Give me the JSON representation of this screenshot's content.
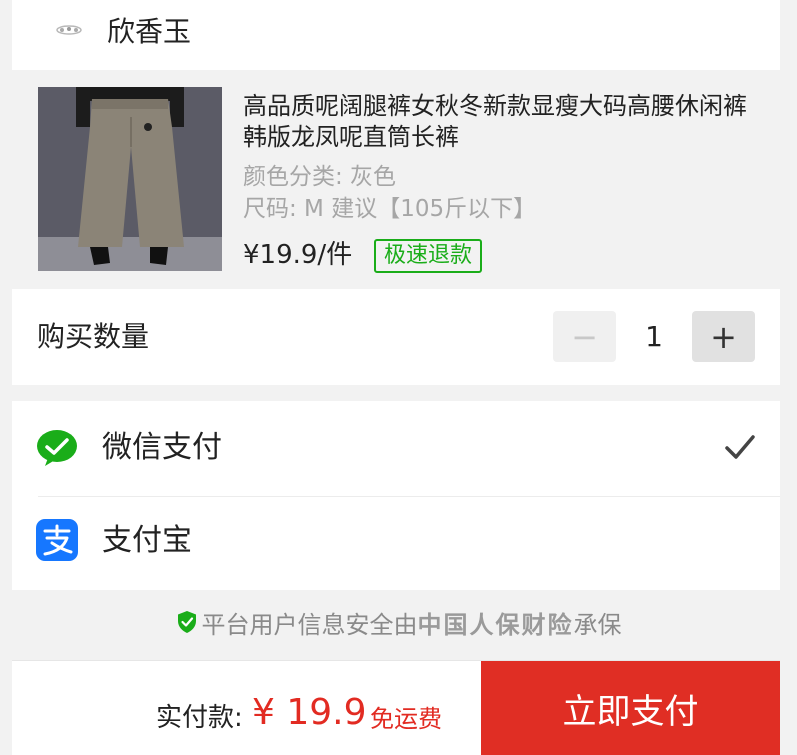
{
  "shop": {
    "name": "欣香玉",
    "logo_icon": "shop-logo-icon"
  },
  "product": {
    "title": "高品质呢阔腿裤女秋冬新款显瘦大码高腰休闲裤韩版龙凤呢直筒长裤",
    "spec_color": "颜色分类: 灰色",
    "spec_size": "尺码: M 建议【105斤以下】",
    "price": "¥19.9/件",
    "badge": "极速退款"
  },
  "quantity": {
    "label": "购买数量",
    "value": "1",
    "minus": "−",
    "plus": "+"
  },
  "payment": {
    "options": [
      {
        "label": "微信支付",
        "icon": "wechat-pay-icon",
        "selected": true
      },
      {
        "label": "支付宝",
        "icon": "alipay-icon",
        "selected": false
      }
    ]
  },
  "security": {
    "text": "平台用户信息安全由",
    "insurer": "中国人保财险",
    "suffix": "承保"
  },
  "footer": {
    "total_label": "实付款:",
    "total_price": "¥ 19.9",
    "shipping": "免运费",
    "pay_button": "立即支付"
  },
  "colors": {
    "accent": "#e02e24",
    "wechat_green": "#1aad19",
    "alipay_blue": "#1677ff"
  }
}
